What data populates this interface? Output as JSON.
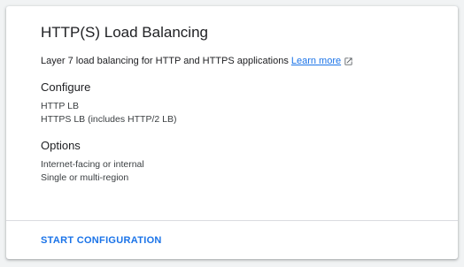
{
  "card": {
    "title": "HTTP(S) Load Balancing",
    "description": "Layer 7 load balancing for HTTP and HTTPS applications",
    "learn_more": "Learn more",
    "configure": {
      "heading": "Configure",
      "items": [
        "HTTP LB",
        "HTTPS LB (includes HTTP/2 LB)"
      ]
    },
    "options": {
      "heading": "Options",
      "items": [
        "Internet-facing or internal",
        "Single or multi-region"
      ]
    },
    "action_label": "START CONFIGURATION"
  },
  "icons": {
    "learn_more": "external-link-icon"
  },
  "colors": {
    "accent": "#1a73e8",
    "text": "#202124",
    "divider": "#dadce0",
    "background": "#f1f3f4"
  }
}
